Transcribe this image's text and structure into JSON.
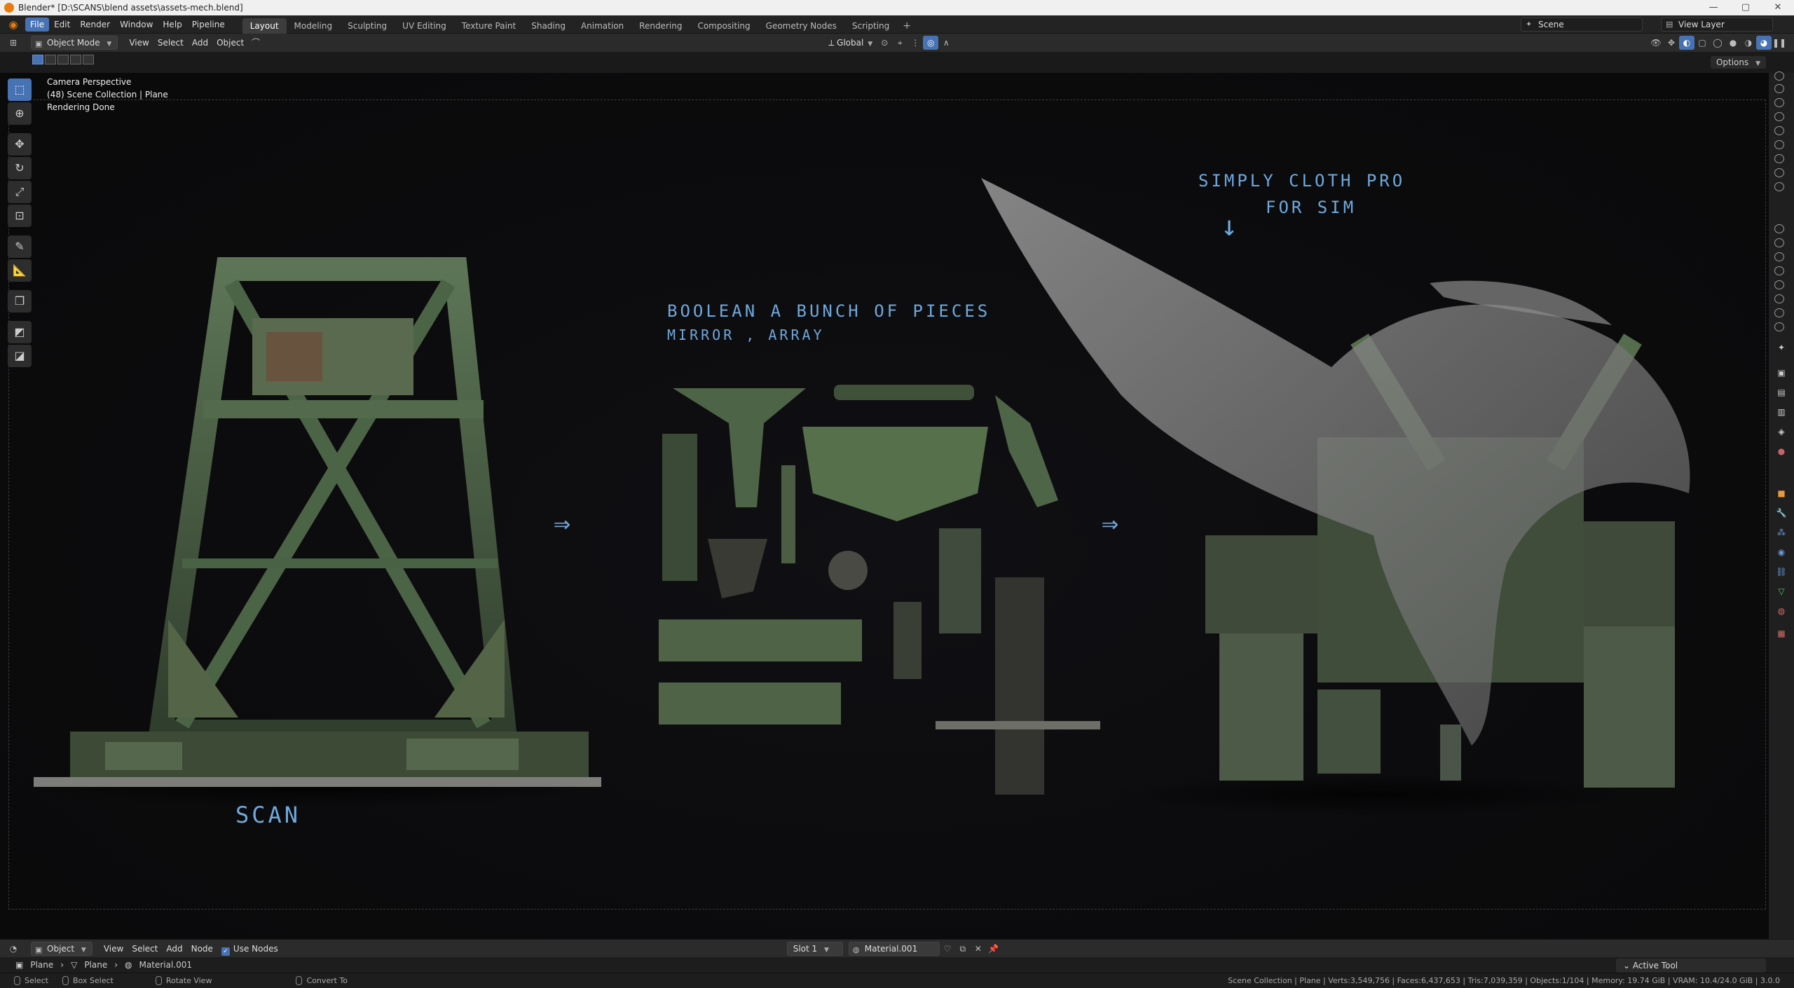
{
  "window": {
    "title": "Blender* [D:\\SCANS\\blend assets\\assets-mech.blend]",
    "controls": [
      "—",
      "▢",
      "✕"
    ]
  },
  "menu": {
    "items": [
      "File",
      "Edit",
      "Render",
      "Window",
      "Help",
      "Pipeline"
    ],
    "active": "File"
  },
  "workspaces": {
    "tabs": [
      "Layout",
      "Modeling",
      "Sculpting",
      "UV Editing",
      "Texture Paint",
      "Shading",
      "Animation",
      "Rendering",
      "Compositing",
      "Geometry Nodes",
      "Scripting"
    ],
    "active": "Layout",
    "add": "+"
  },
  "scene": {
    "name": "Scene",
    "view_layer": "View Layer"
  },
  "viewport_header": {
    "mode": "Object Mode",
    "menus": [
      "View",
      "Select",
      "Add",
      "Object"
    ],
    "orientation": "Global"
  },
  "options_label": "Options",
  "viewport_overlay": {
    "line1": "Camera Perspective",
    "line2": "(48) Scene Collection | Plane",
    "line3": "Rendering Done"
  },
  "annotations": {
    "scan": "SCAN",
    "boolean_line1": "BOOLEAN A BUNCH OF PIECES",
    "boolean_line2": "MIRROR , ARRAY",
    "cloth_line1": "SIMPLY CLOTH PRO",
    "cloth_line2": "FOR SIM",
    "arrow": "⇒"
  },
  "icons": {
    "tools": [
      "select-box-icon",
      "cursor-icon",
      "move-icon",
      "rotate-icon",
      "scale-icon",
      "transform-icon",
      "annotate-icon",
      "measure-icon",
      "add-cube-icon",
      "extrude-icon",
      "shrink-icon"
    ]
  },
  "shader_header": {
    "editor_type": "Object",
    "menus": [
      "View",
      "Select",
      "Add",
      "Node"
    ],
    "use_nodes": "Use Nodes",
    "slot": "Slot 1",
    "material": "Material.001"
  },
  "breadcrumb": [
    "Plane",
    "Plane",
    "Material.001"
  ],
  "active_tool_label": "Active Tool",
  "statusbar": {
    "select": "Select",
    "box_select": "Box Select",
    "rotate_view": "Rotate View",
    "convert_to": "Convert To",
    "stats": "Scene Collection | Plane | Verts:3,549,756 | Faces:6,437,653 | Tris:7,039,359 | Objects:1/104 | Memory: 19.74 GiB | VRAM: 10.4/24.0 GiB | 3.0.0"
  },
  "colors": {
    "accent": "#4772b3",
    "annotation": "#6fa8dc",
    "blender_orange": "#e87d0d"
  }
}
